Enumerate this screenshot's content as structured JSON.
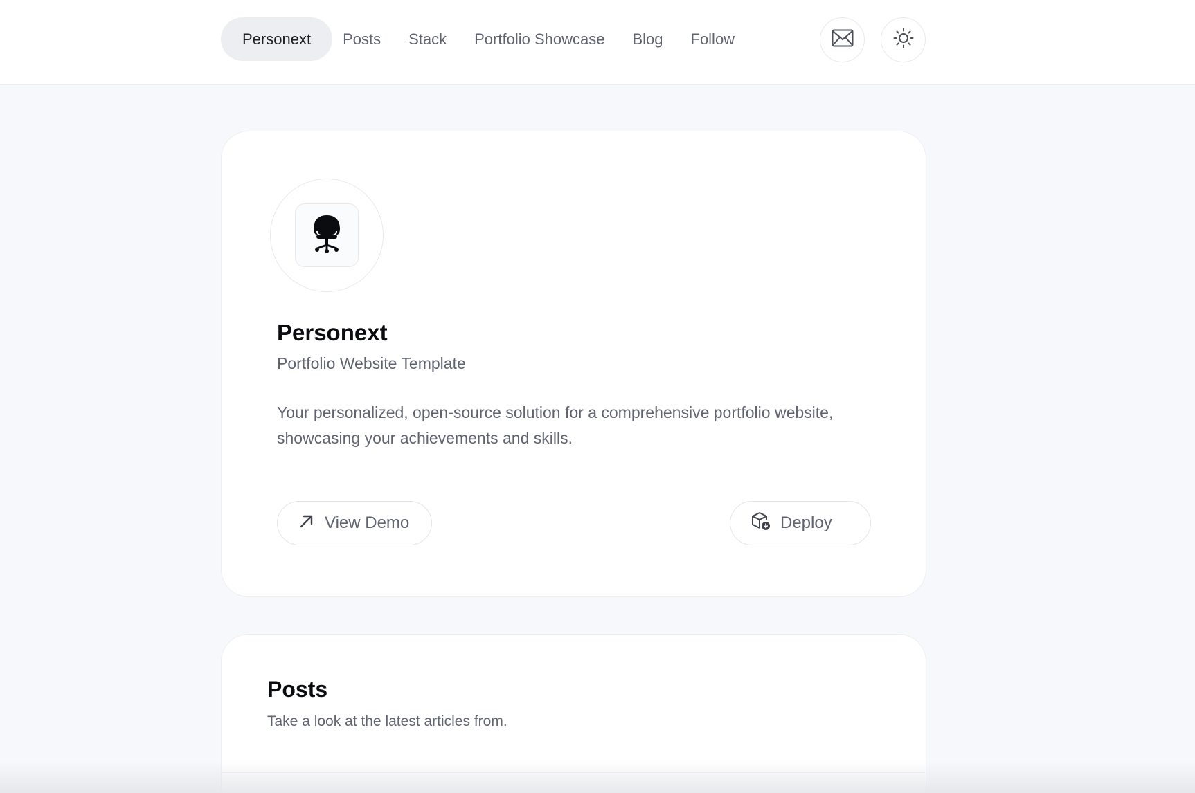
{
  "nav": {
    "items": [
      {
        "label": "Personext",
        "active": true
      },
      {
        "label": "Posts",
        "active": false
      },
      {
        "label": "Stack",
        "active": false
      },
      {
        "label": "Portfolio Showcase",
        "active": false
      },
      {
        "label": "Blog",
        "active": false
      },
      {
        "label": "Follow",
        "active": false
      }
    ],
    "mail_icon": "mail-icon",
    "theme_icon": "sun-icon"
  },
  "hero": {
    "logo_icon": "office-chair-icon",
    "title": "Personext",
    "subtitle": "Portfolio Website Template",
    "description": "Your personalized, open-source solution for a comprehensive portfolio website, showcasing your achievements and skills.",
    "demo_label": "View Demo",
    "demo_icon": "arrow-up-right-icon",
    "deploy_label": "Deploy",
    "deploy_icon": "package-deploy-icon"
  },
  "posts": {
    "title": "Posts",
    "subtitle": "Take a look at the latest articles from."
  },
  "colors": {
    "background": "#f7f8fb",
    "card": "#ffffff",
    "muted_text": "#5f6470",
    "active_pill": "#eceef1"
  }
}
